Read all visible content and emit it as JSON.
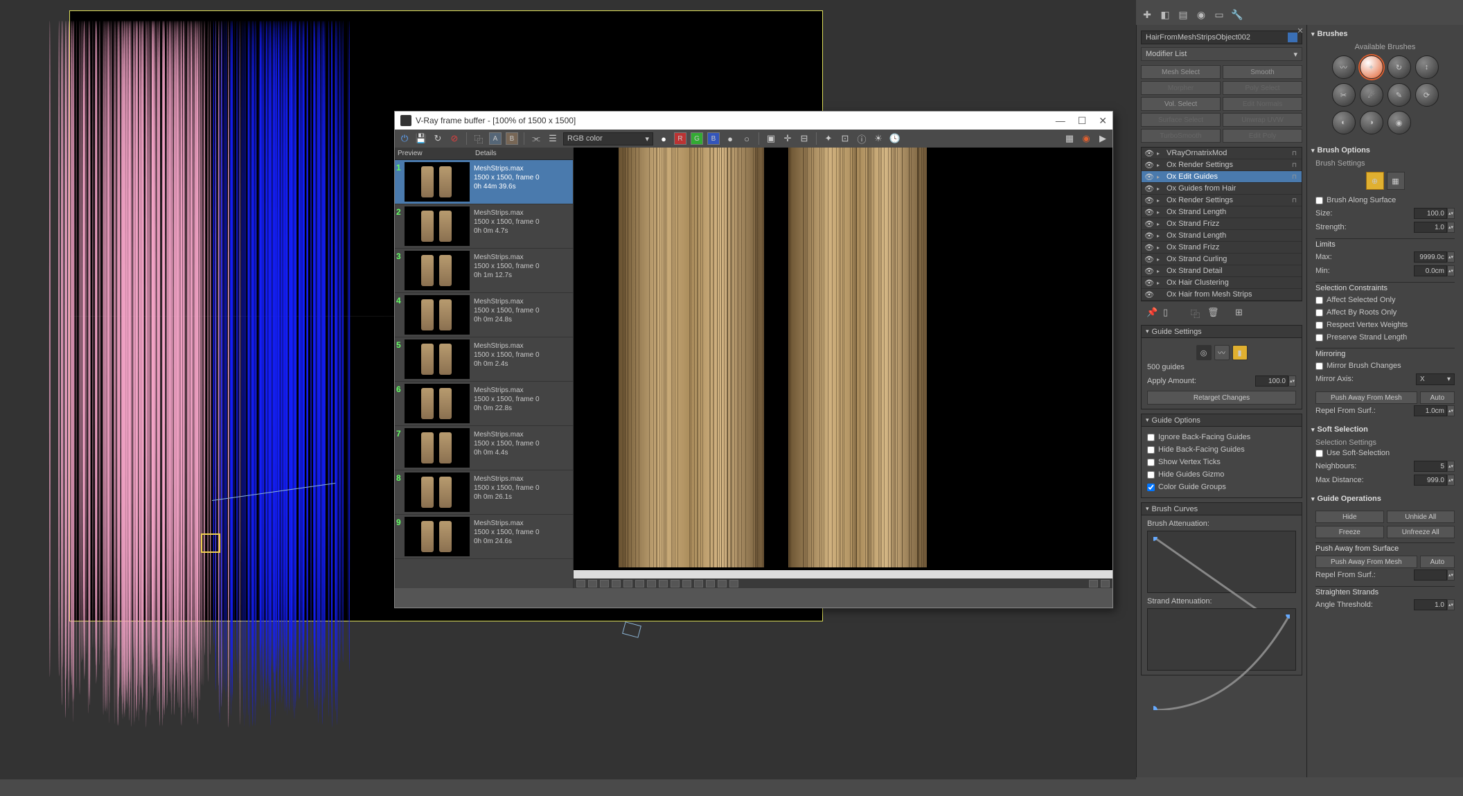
{
  "vfb": {
    "title": "V-Ray frame buffer - [100% of 1500 x 1500]",
    "channel": "RGB color",
    "hdr": {
      "preview": "Preview",
      "details": "Details"
    },
    "history": [
      {
        "n": "1",
        "name": "MeshStrips.max",
        "res": "1500 x 1500, frame 0",
        "time": "0h 44m 39.6s",
        "sel": true
      },
      {
        "n": "2",
        "name": "MeshStrips.max",
        "res": "1500 x 1500, frame 0",
        "time": "0h 0m 4.7s"
      },
      {
        "n": "3",
        "name": "MeshStrips.max",
        "res": "1500 x 1500, frame 0",
        "time": "0h 1m 12.7s"
      },
      {
        "n": "4",
        "name": "MeshStrips.max",
        "res": "1500 x 1500, frame 0",
        "time": "0h 0m 24.8s"
      },
      {
        "n": "5",
        "name": "MeshStrips.max",
        "res": "1500 x 1500, frame 0",
        "time": "0h 0m 2.4s"
      },
      {
        "n": "6",
        "name": "MeshStrips.max",
        "res": "1500 x 1500, frame 0",
        "time": "0h 0m 22.8s"
      },
      {
        "n": "7",
        "name": "MeshStrips.max",
        "res": "1500 x 1500, frame 0",
        "time": "0h 0m 4.4s"
      },
      {
        "n": "8",
        "name": "MeshStrips.max",
        "res": "1500 x 1500, frame 0",
        "time": "0h 0m 26.1s"
      },
      {
        "n": "9",
        "name": "MeshStrips.max",
        "res": "1500 x 1500, frame 0",
        "time": "0h 0m 24.6s"
      }
    ]
  },
  "mod": {
    "object_name": "HairFromMeshStripsObject002",
    "modlist": "Modifier List",
    "btns": [
      "Mesh Select",
      "Smooth",
      "Morpher",
      "Poly Select",
      "Vol. Select",
      "Edit Normals",
      "Surface Select",
      "Unwrap UVW",
      "TurboSmooth",
      "Edit Poly"
    ],
    "stack": [
      {
        "name": "VRayOrnatrixMod"
      },
      {
        "name": "Ox Render Settings"
      },
      {
        "name": "Ox Edit Guides",
        "sel": true
      },
      {
        "name": "Ox Guides from Hair"
      },
      {
        "name": "Ox Render Settings"
      },
      {
        "name": "Ox Strand Length"
      },
      {
        "name": "Ox Strand Frizz"
      },
      {
        "name": "Ox Strand Length"
      },
      {
        "name": "Ox Strand Frizz"
      },
      {
        "name": "Ox Strand Curling"
      },
      {
        "name": "Ox Strand Detail"
      },
      {
        "name": "Ox Hair Clustering"
      },
      {
        "name": "Ox Hair from Mesh Strips",
        "base": true
      }
    ],
    "guide_settings": {
      "title": "Guide Settings",
      "count": "500 guides",
      "apply_label": "Apply Amount:",
      "apply_val": "100.0",
      "retarget": "Retarget Changes"
    },
    "guide_options": {
      "title": "Guide Options",
      "o1": "Ignore Back-Facing Guides",
      "o2": "Hide Back-Facing Guides",
      "o3": "Show Vertex Ticks",
      "o4": "Hide Guides Gizmo",
      "o5": "Color Guide Groups"
    },
    "brush_curves": {
      "title": "Brush Curves",
      "l1": "Brush Attenuation:",
      "l2": "Strand Attenuation:"
    }
  },
  "brush": {
    "title": "Brushes",
    "avail": "Available Brushes",
    "opts_title": "Brush Options",
    "settings": "Brush Settings",
    "along": "Brush Along Surface",
    "size_l": "Size:",
    "size_v": "100.0",
    "str_l": "Strength:",
    "str_v": "1.0",
    "limits": "Limits",
    "max_l": "Max:",
    "max_v": "9999.0c",
    "min_l": "Min:",
    "min_v": "0.0cm",
    "selc": "Selection Constraints",
    "sc1": "Affect Selected Only",
    "sc2": "Affect By Roots Only",
    "sc3": "Respect Vertex Weights",
    "sc4": "Preserve Strand Length",
    "mir": "Mirroring",
    "mir1": "Mirror Brush Changes",
    "mir_axis_l": "Mirror Axis:",
    "mir_axis_v": "X",
    "push_btn": "Push Away From Mesh",
    "auto": "Auto",
    "repel_l": "Repel From Surf.:",
    "repel_v": "1.0cm",
    "softsel": "Soft Selection",
    "ss_sub": "Selection Settings",
    "ss_use": "Use Soft-Selection",
    "neigh_l": "Neighbours:",
    "neigh_v": "5",
    "maxd_l": "Max Distance:",
    "maxd_v": "999.0",
    "gops": "Guide Operations",
    "hide": "Hide",
    "unhide": "Unhide All",
    "freeze": "Freeze",
    "unfreeze": "Unfreeze All",
    "pas": "Push Away from Surface",
    "push2": "Push Away From Mesh",
    "auto2": "Auto",
    "repel2_l": "Repel From Surf.:",
    "straight": "Straighten Strands",
    "ang_l": "Angle Threshold:",
    "ang_v": "1.0"
  }
}
